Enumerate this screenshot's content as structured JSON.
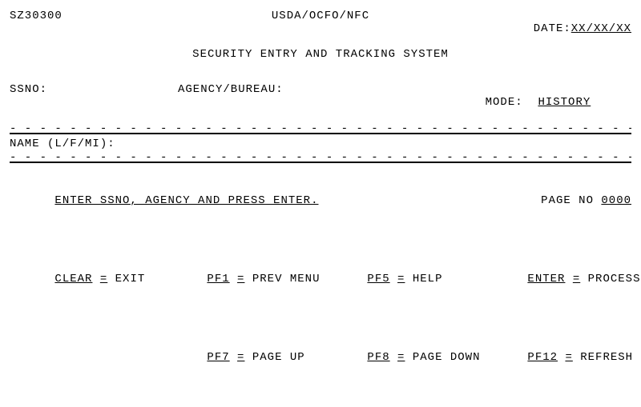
{
  "dashes": "- - - - - - - - - - - - - - - - - - - - - - - - - - - - - - - - - - - - - - - - - - - - - - - - - - - - - - - - - - - - - - - - - - - - - - -",
  "header": {
    "screen_id": "SZ30300",
    "org": "USDA/OCFO/NFC",
    "date_label": "DATE:",
    "date_value": "XX/XX/XX",
    "title": "SECURITY ENTRY AND TRACKING SYSTEM"
  },
  "fields": {
    "ssno_label": "SSNO:",
    "agency_label": "AGENCY/BUREAU:",
    "mode_label": "MODE:",
    "mode_value": "HISTORY",
    "name_label": "NAME (L/F/MI):"
  },
  "footer": {
    "prompt": "ENTER SSNO, AGENCY AND PRESS ENTER.",
    "page_no_label": "PAGE NO",
    "page_no_value": "0000",
    "keys": {
      "clear_lbl": "CLEAR",
      "clear_eq": "=",
      "clear_txt": "EXIT",
      "pf1_lbl": "PF1",
      "pf1_eq": "=",
      "pf1_txt": "PREV MENU",
      "pf5_lbl": "PF5",
      "pf5_eq": "=",
      "pf5_txt": "HELP",
      "enter_lbl": "ENTER",
      "enter_eq": "=",
      "enter_txt": "PROCESS",
      "pf7_lbl": "PF7",
      "pf7_eq": "=",
      "pf7_txt": "PAGE UP",
      "pf8_lbl": "PF8",
      "pf8_eq": "=",
      "pf8_txt": "PAGE DOWN",
      "pf12_lbl": "PF12",
      "pf12_eq": "=",
      "pf12_txt": "REFRESH"
    }
  }
}
